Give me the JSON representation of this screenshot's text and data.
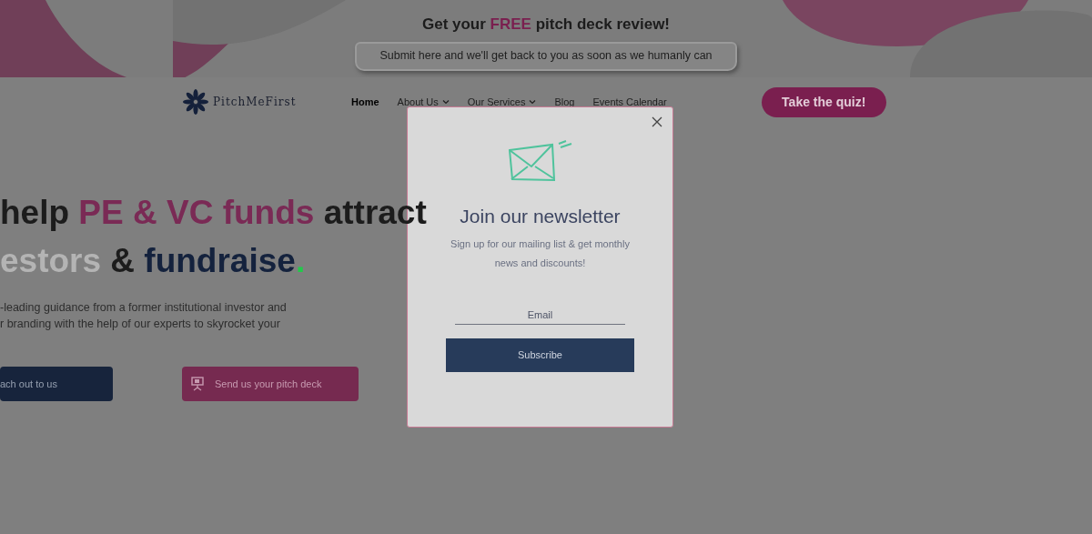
{
  "banner": {
    "headline": "Get your **FREE** pitch deck review!",
    "button": "Submit here and we'll get back to you as soon as we humanly can"
  },
  "nav": {
    "logo": "PitchMeFirst",
    "items": [
      {
        "label": "Home",
        "selected": true,
        "dropdown": false
      },
      {
        "label": "About Us",
        "selected": false,
        "dropdown": true
      },
      {
        "label": "Our Services",
        "selected": false,
        "dropdown": true
      },
      {
        "label": "Blog",
        "selected": false,
        "dropdown": false
      },
      {
        "label": "Events Calendar",
        "selected": false,
        "dropdown": false
      }
    ],
    "cta": "Take the quiz!"
  },
  "hero": {
    "heading_lines": [
      [
        {
          "text": "help ",
          "kind": "dark"
        },
        {
          "text": "PE & VC funds",
          "kind": "accent"
        },
        {
          "text": " attract",
          "kind": "dark"
        }
      ],
      [
        {
          "text": "estors",
          "kind": "muted"
        },
        {
          "text": " & ",
          "kind": "dark"
        },
        {
          "text": "fundraise",
          "kind": "navy"
        },
        {
          "text": ".",
          "kind": "dot"
        }
      ]
    ],
    "text_lines": [
      "-leading guidance from a former institutional investor and",
      "r branding with the help of our experts to skyrocket your"
    ],
    "buttons": [
      {
        "label": "ach out to us",
        "kind": "navy"
      },
      {
        "label": "Send us your pitch deck",
        "kind": "pink"
      }
    ]
  },
  "modal": {
    "title": "Join our newsletter",
    "text": "Sign up for our mailing list & get monthly news and discounts!",
    "email_placeholder": "Email",
    "button": "Subscribe"
  }
}
